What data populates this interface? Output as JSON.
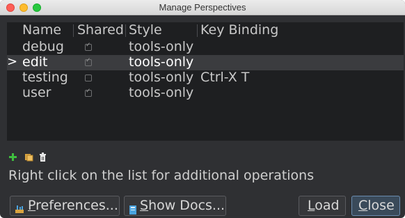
{
  "window": {
    "title": "Manage Perspectives"
  },
  "table": {
    "columns": [
      "Name",
      "Shared",
      "Style",
      "Key Binding"
    ],
    "selected_marker": ">",
    "rows": [
      {
        "name": "debug",
        "shared": true,
        "style": "tools-only",
        "key_binding": ""
      },
      {
        "name": "edit",
        "shared": true,
        "style": "tools-only",
        "key_binding": "",
        "selected": true
      },
      {
        "name": "testing",
        "shared": false,
        "style": "tools-only",
        "key_binding": "Ctrl-X T"
      },
      {
        "name": "user",
        "shared": true,
        "style": "tools-only",
        "key_binding": ""
      }
    ]
  },
  "toolbar_icons": [
    "add-icon",
    "copy-icon",
    "delete-icon"
  ],
  "help_text": "Right click on the list for additional operations",
  "buttons": {
    "preferences": {
      "first": "P",
      "rest": "references..."
    },
    "show_docs": {
      "first": "S",
      "rest": "how Docs..."
    },
    "load": {
      "first": "L",
      "rest": "oad"
    },
    "close": {
      "first": "C",
      "rest": "lose"
    }
  },
  "colors": {
    "background": "#2f3033",
    "list_background": "#1e1f21",
    "selection": "#3b3c3f",
    "add_icon": "#3fbf3f"
  }
}
